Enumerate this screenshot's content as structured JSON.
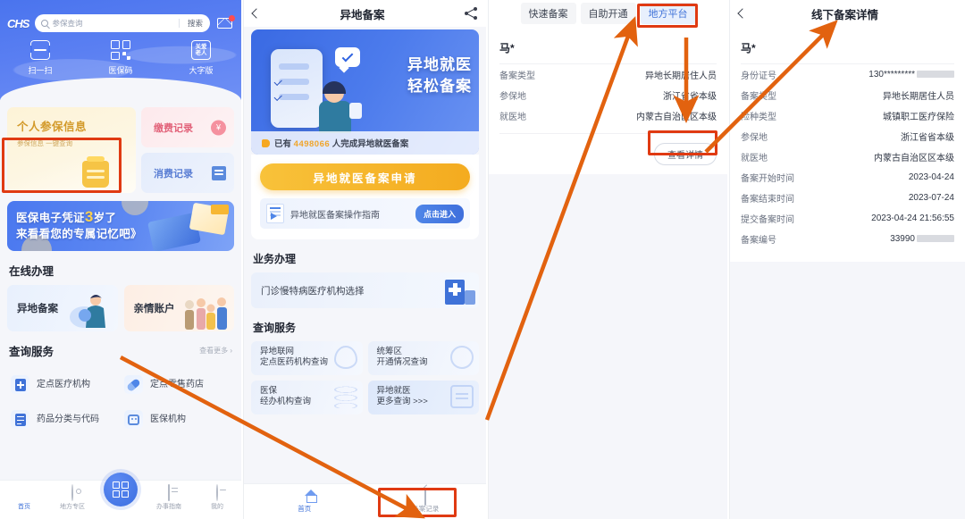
{
  "panel1": {
    "logo": "CHS",
    "search": {
      "placeholder": "参保查询",
      "button": "搜索",
      "icon": "search-icon",
      "mail_icon": "mail-icon"
    },
    "features": [
      {
        "label": "扫一扫",
        "icon": "scan-icon"
      },
      {
        "label": "医保码",
        "icon": "qr-code-icon"
      },
      {
        "label": "大字版",
        "icon": "elder-care-icon",
        "glyph": "关爱\n老人"
      }
    ],
    "info_card": {
      "title": "个人参保信息",
      "subtitle": "参保信息 一键查询"
    },
    "mini_cards": [
      {
        "title": "缴费记录",
        "icon": "coin-icon"
      },
      {
        "title": "消费记录",
        "icon": "receipt-icon"
      }
    ],
    "promo": {
      "line1": "医保电子凭证",
      "big": "3",
      "line1b": "岁了",
      "line2": "来看看您的专属记忆吧》"
    },
    "online": {
      "title": "在线办理",
      "items": [
        {
          "label": "异地备案",
          "highlighted": true
        },
        {
          "label": "亲情账户",
          "highlighted": false
        }
      ]
    },
    "query": {
      "title": "查询服务",
      "more": "查看更多 ›",
      "items": [
        {
          "label": "定点医疗机构",
          "icon": "hospital-icon"
        },
        {
          "label": "定点零售药店",
          "icon": "pill-icon"
        },
        {
          "label": "药品分类与代码",
          "icon": "book-icon"
        },
        {
          "label": "医保机构",
          "icon": "robot-icon"
        }
      ]
    },
    "tabbar": [
      {
        "label": "首页",
        "icon": "shield-home-icon",
        "active": true
      },
      {
        "label": "地方专区",
        "icon": "location-pin-icon",
        "active": false
      },
      {
        "label": "办事指南",
        "icon": "document-icon",
        "active": false
      },
      {
        "label": "我的",
        "icon": "profile-icon",
        "active": false
      }
    ],
    "fab": {
      "icon": "qr-scan-fab-icon"
    }
  },
  "panel2": {
    "header": {
      "back_icon": "back-chevron-icon",
      "title": "异地备案",
      "share_icon": "share-icon"
    },
    "banner": {
      "title_line1": "异地就医",
      "title_line2": "轻松备案",
      "stat_prefix": "已有",
      "stat_number": "4498066",
      "stat_suffix": "人完成异地就医备案",
      "speaker_icon": "megaphone-icon"
    },
    "apply_button": "异地就医备案申请",
    "guide": {
      "icon": "guide-doc-icon",
      "label": "异地就医备案操作指南",
      "button": "点击进入"
    },
    "business": {
      "title": "业务办理",
      "item": "门诊慢特病医疗机构选择",
      "icon": "hospital-building-icon"
    },
    "query": {
      "title": "查询服务",
      "items": [
        {
          "line1": "异地联网",
          "line2": "定点医药机构查询",
          "icon": "pin-outline-icon"
        },
        {
          "line1": "统筹区",
          "line2": "开通情况查询",
          "icon": "circle-pin-icon"
        },
        {
          "line1": "医保",
          "line2": "经办机构查询",
          "icon": "waves-icon"
        },
        {
          "line1": "异地就医",
          "line2": "更多查询 >>>",
          "icon": "transfer-icon",
          "highlighted": true
        }
      ]
    },
    "tabbar": [
      {
        "label": "首页",
        "icon": "home-icon",
        "active": true
      },
      {
        "label": "备案记录",
        "icon": "record-icon",
        "active": false,
        "highlighted": true
      }
    ]
  },
  "panel3": {
    "tabs": [
      {
        "label": "快速备案",
        "selected": false
      },
      {
        "label": "自助开通",
        "selected": false
      },
      {
        "label": "地方平台",
        "selected": true,
        "highlighted": true
      }
    ],
    "record": {
      "name": "马*",
      "rows": [
        {
          "key": "备案类型",
          "value": "异地长期居住人员"
        },
        {
          "key": "参保地",
          "value": "浙江省省本级"
        },
        {
          "key": "就医地",
          "value": "内蒙古自治区区本级"
        }
      ],
      "detail_button": "查看详情",
      "detail_button_highlighted": true
    }
  },
  "panel4": {
    "header": {
      "back_icon": "back-chevron-icon",
      "title": "线下备案详情"
    },
    "record": {
      "name": "马*",
      "rows": [
        {
          "key": "身份证号",
          "value": "130*********",
          "masked": true
        },
        {
          "key": "备案类型",
          "value": "异地长期居住人员",
          "masked": false
        },
        {
          "key": "险种类型",
          "value": "城镇职工医疗保险",
          "masked": false
        },
        {
          "key": "参保地",
          "value": "浙江省省本级",
          "masked": false
        },
        {
          "key": "就医地",
          "value": "内蒙古自治区区本级",
          "masked": false
        },
        {
          "key": "备案开始时间",
          "value": "2023-04-24",
          "masked": false
        },
        {
          "key": "备案结束时间",
          "value": "2023-07-24",
          "masked": false
        },
        {
          "key": "提交备案时间",
          "value": "2023-04-24 21:56:55",
          "masked": false
        },
        {
          "key": "备案编号",
          "value": "33990",
          "masked": true
        }
      ]
    }
  },
  "annotations": {
    "color": "#e2620f",
    "highlight_color": "#e03a12",
    "arrows": [
      {
        "from": "panel1-yidi-beian-card",
        "to": "panel2-beian-record-tab"
      },
      {
        "from": "panel2-beian-record-tab",
        "to": "panel3-local-platform-tab"
      },
      {
        "from": "panel3-view-detail-button",
        "to": "panel3-local-platform-tab"
      },
      {
        "from": "panel3-view-detail-button",
        "to": "panel4-title"
      }
    ]
  }
}
